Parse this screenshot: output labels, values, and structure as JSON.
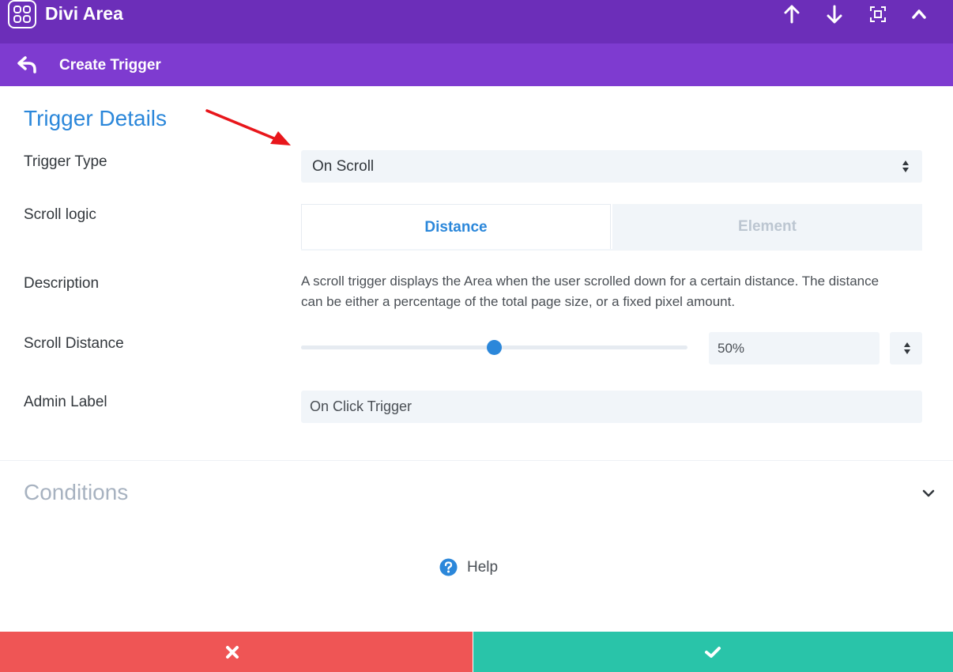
{
  "app": {
    "title": "Divi Area",
    "header_icons": [
      "arrow-up-icon",
      "arrow-down-icon",
      "fullscreen-icon",
      "chevron-up-icon"
    ]
  },
  "subheader": {
    "back_icon": "back-arrow-icon",
    "title": "Create Trigger"
  },
  "trigger_details": {
    "title": "Trigger Details",
    "trigger_type": {
      "label": "Trigger Type",
      "value": "On Scroll"
    },
    "scroll_logic": {
      "label": "Scroll logic",
      "tabs": [
        {
          "label": "Distance",
          "active": true
        },
        {
          "label": "Element",
          "active": false
        }
      ]
    },
    "description": {
      "label": "Description",
      "text": "A scroll trigger displays the Area when the user scrolled down for a certain distance. The distance can be either a percentage of the total page size, or a fixed pixel amount."
    },
    "scroll_distance": {
      "label": "Scroll Distance",
      "value_text": "50%",
      "slider_fraction": 0.5
    },
    "admin_label": {
      "label": "Admin Label",
      "value": "On Click Trigger"
    }
  },
  "conditions": {
    "title": "Conditions"
  },
  "help": {
    "label": "Help"
  },
  "footer": {
    "cancel_icon": "close-icon",
    "save_icon": "checkmark-icon"
  },
  "colors": {
    "header": "#6c2eb9",
    "subheader": "#7e3bd0",
    "accent": "#2b87da",
    "cancel": "#ef5555",
    "save": "#29c4a9",
    "annotation_arrow": "#e8161b"
  }
}
